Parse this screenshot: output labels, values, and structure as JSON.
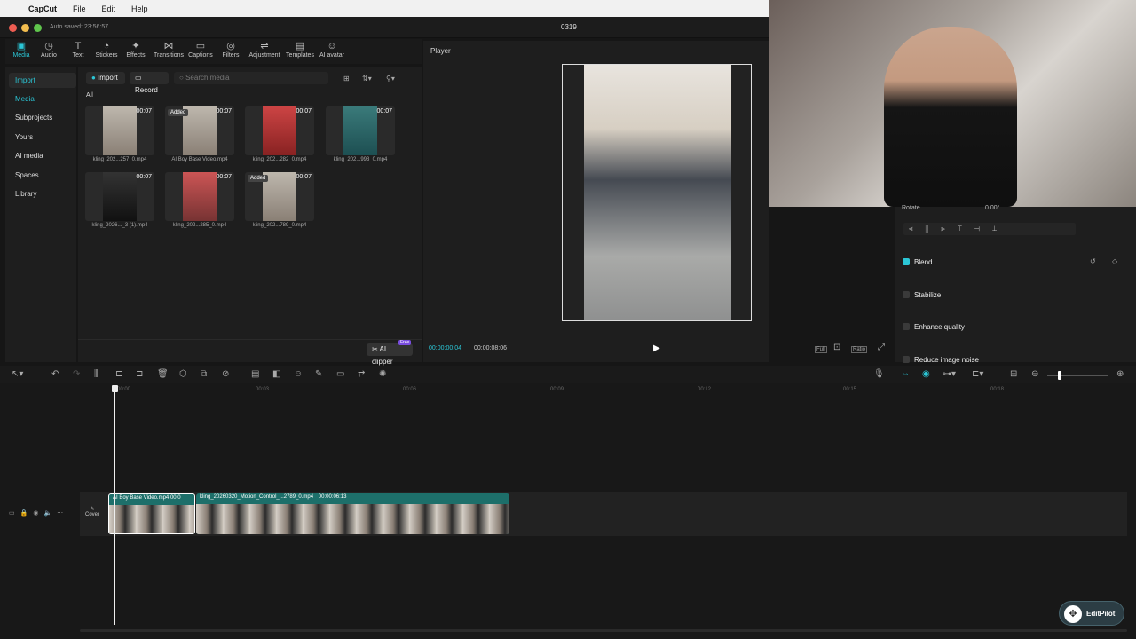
{
  "menubar": {
    "app": "CapCut",
    "items": [
      "File",
      "Edit",
      "Help"
    ]
  },
  "titlebar": {
    "autosave": "Auto saved: 23:56:57",
    "project": "0319"
  },
  "toolbar": [
    {
      "label": "Media",
      "icon": "media-icon"
    },
    {
      "label": "Audio",
      "icon": "audio-icon"
    },
    {
      "label": "Text",
      "icon": "text-icon"
    },
    {
      "label": "Stickers",
      "icon": "stickers-icon"
    },
    {
      "label": "Effects",
      "icon": "effects-icon"
    },
    {
      "label": "Transitions",
      "icon": "transitions-icon"
    },
    {
      "label": "Captions",
      "icon": "captions-icon"
    },
    {
      "label": "Filters",
      "icon": "filters-icon"
    },
    {
      "label": "Adjustment",
      "icon": "adjustment-icon"
    },
    {
      "label": "Templates",
      "icon": "templates-icon"
    },
    {
      "label": "AI avatar",
      "icon": "ai-avatar-icon"
    }
  ],
  "sidenav": [
    "Import",
    "Media",
    "Subprojects",
    "Yours",
    "AI media",
    "Spaces",
    "Library"
  ],
  "media": {
    "import": "Import",
    "record": "Record",
    "search_placeholder": "Search media",
    "tab_all": "All",
    "ai_clipper": "AI clipper",
    "free": "Free",
    "items": [
      {
        "name": "kling_202...257_0.mp4",
        "dur": "00:07",
        "added": ""
      },
      {
        "name": "AI Boy Base Video.mp4",
        "dur": "00:07",
        "added": "Added"
      },
      {
        "name": "kling_202...282_0.mp4",
        "dur": "00:07",
        "added": ""
      },
      {
        "name": "kling_202...993_0.mp4",
        "dur": "00:07",
        "added": ""
      },
      {
        "name": "kling_2026..._3 (1).mp4",
        "dur": "00:07",
        "added": ""
      },
      {
        "name": "kling_202...285_0.mp4",
        "dur": "00:07",
        "added": ""
      },
      {
        "name": "kling_202...789_0.mp4",
        "dur": "00:07",
        "added": "Added"
      }
    ]
  },
  "player": {
    "title": "Player",
    "current": "00:00:00:04",
    "total": "00:00:08:06",
    "full": "Full",
    "ratio": "Ratio"
  },
  "right": {
    "rotate": "Rotate",
    "rotate_value": "0.00°",
    "blend": "Blend",
    "stabilize": "Stabilize",
    "enhance": "Enhance quality",
    "noise": "Reduce image noise"
  },
  "ruler": [
    "00:00",
    "00:03",
    "00:06",
    "00:09",
    "00:12",
    "00:15",
    "00:18"
  ],
  "clips": [
    {
      "label": "AI Boy Base Video.mp4",
      "dur": "00:0"
    },
    {
      "label": "kling_20260320_Motion_Control_...2789_0.mp4",
      "dur": "00:00:06:13"
    }
  ],
  "cover": "Cover",
  "editpilot": "EditPilot",
  "colors": {
    "accent": "#2bc6d6",
    "clip": "#1d6f6a"
  }
}
